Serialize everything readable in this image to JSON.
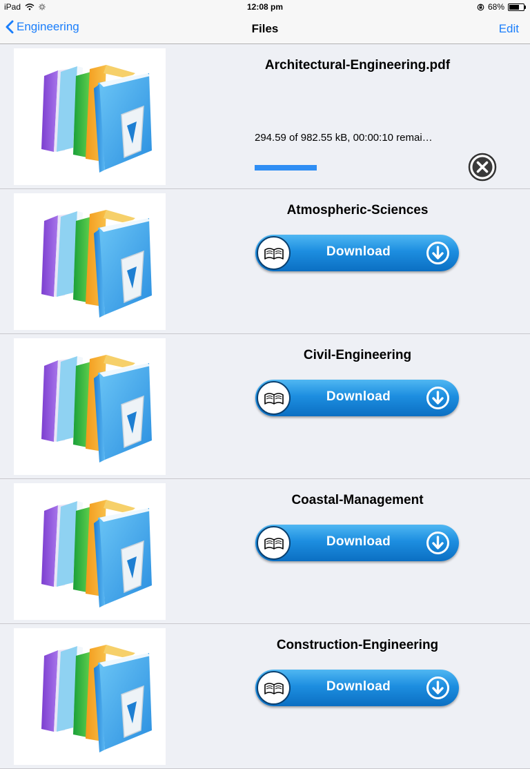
{
  "status": {
    "device": "iPad",
    "time": "12:08 pm",
    "battery_text": "68%",
    "battery_level": 0.68
  },
  "nav": {
    "back_label": "Engineering",
    "title": "Files",
    "edit_label": "Edit"
  },
  "files": [
    {
      "name": "Architectural-Engineering.pdf",
      "state": "downloading",
      "progress_text": "294.59 of 982.55 kB, 00:00:10 remai…",
      "progress": 0.3
    },
    {
      "name": "Atmospheric-Sciences",
      "state": "idle",
      "button_label": "Download"
    },
    {
      "name": "Civil-Engineering",
      "state": "idle",
      "button_label": "Download"
    },
    {
      "name": "Coastal-Management",
      "state": "idle",
      "button_label": "Download"
    },
    {
      "name": "Construction-Engineering",
      "state": "idle",
      "button_label": "Download"
    }
  ],
  "colors": {
    "accent": "#1a7efb",
    "progress": "#2f8ef4",
    "button_top": "#4fb7f2",
    "button_bottom": "#0b6fc3"
  }
}
